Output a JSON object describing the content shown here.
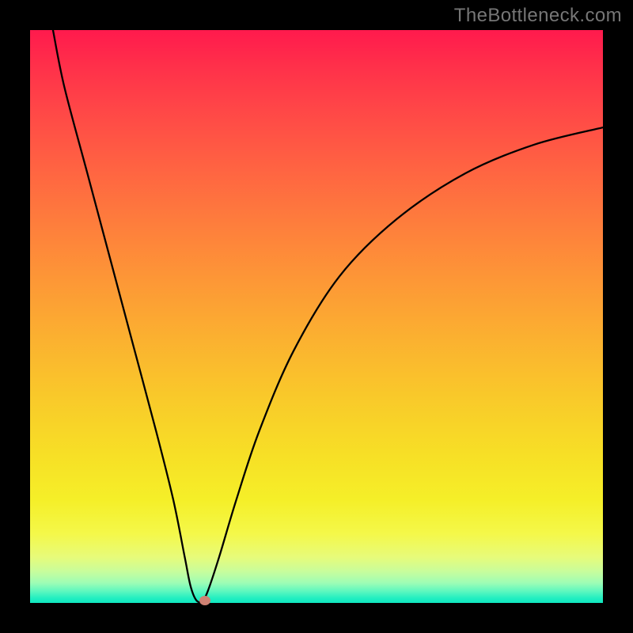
{
  "watermark": "TheBottleneck.com",
  "chart_data": {
    "type": "line",
    "title": "",
    "xlabel": "",
    "ylabel": "",
    "xlim": [
      0,
      100
    ],
    "ylim": [
      0,
      100
    ],
    "grid": false,
    "curve_points": [
      {
        "x": 4,
        "y": 100
      },
      {
        "x": 6,
        "y": 90
      },
      {
        "x": 10,
        "y": 75
      },
      {
        "x": 14,
        "y": 60
      },
      {
        "x": 18,
        "y": 45
      },
      {
        "x": 22,
        "y": 30
      },
      {
        "x": 25,
        "y": 18
      },
      {
        "x": 27,
        "y": 8
      },
      {
        "x": 28,
        "y": 3
      },
      {
        "x": 29,
        "y": 0.5
      },
      {
        "x": 30,
        "y": 0.3
      },
      {
        "x": 31,
        "y": 2
      },
      {
        "x": 33,
        "y": 8
      },
      {
        "x": 36,
        "y": 18
      },
      {
        "x": 40,
        "y": 30
      },
      {
        "x": 46,
        "y": 44
      },
      {
        "x": 54,
        "y": 57
      },
      {
        "x": 64,
        "y": 67
      },
      {
        "x": 76,
        "y": 75
      },
      {
        "x": 88,
        "y": 80
      },
      {
        "x": 100,
        "y": 83
      }
    ],
    "marker": {
      "x": 30.5,
      "y": 0.4,
      "color": "#cf8173"
    },
    "gradient_stops": [
      {
        "pos": 0,
        "color": "#ff1a4d"
      },
      {
        "pos": 50,
        "color": "#fbb130"
      },
      {
        "pos": 85,
        "color": "#f5ef28"
      },
      {
        "pos": 100,
        "color": "#0fe8c0"
      }
    ]
  }
}
